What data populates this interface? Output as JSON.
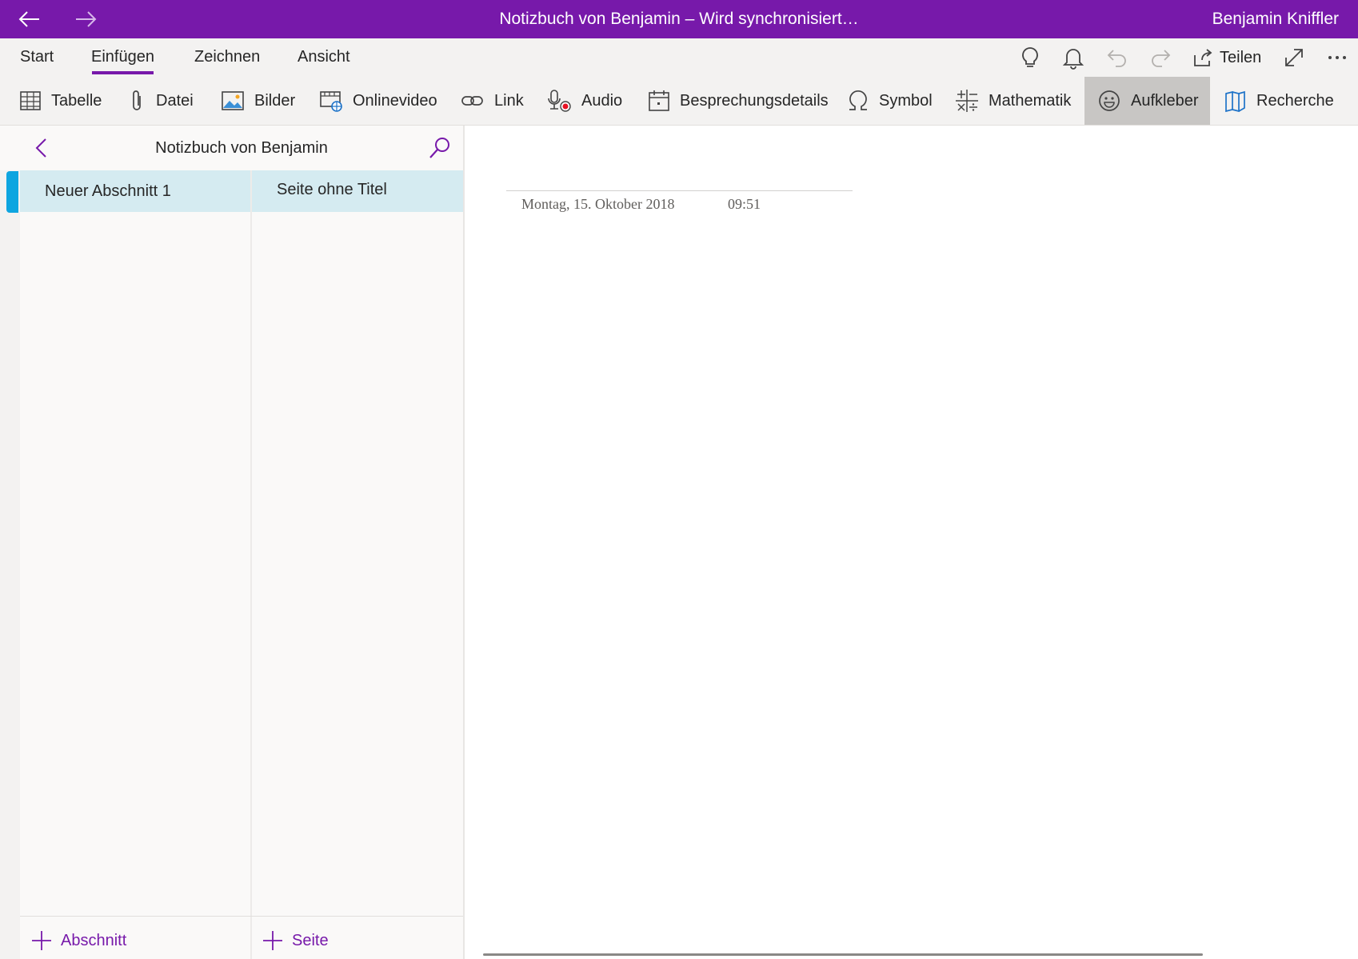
{
  "titlebar": {
    "title": "Notizbuch von Benjamin – Wird synchronisiert…",
    "user": "Benjamin Kniffler"
  },
  "tabs": [
    {
      "label": "Start"
    },
    {
      "label": "Einfügen"
    },
    {
      "label": "Zeichnen"
    },
    {
      "label": "Ansicht"
    }
  ],
  "active_tab": "Einfügen",
  "quick_actions": {
    "share_label": "Teilen"
  },
  "commands": [
    {
      "label": "Tabelle",
      "icon": "table-icon"
    },
    {
      "label": "Datei",
      "icon": "paperclip-icon"
    },
    {
      "label": "Bilder",
      "icon": "image-icon"
    },
    {
      "label": "Onlinevideo",
      "icon": "online-video-icon"
    },
    {
      "label": "Link",
      "icon": "link-icon"
    },
    {
      "label": "Audio",
      "icon": "audio-record-icon"
    },
    {
      "label": "Besprechungsdetails",
      "icon": "calendar-icon"
    },
    {
      "label": "Symbol",
      "icon": "omega-icon"
    },
    {
      "label": "Mathematik",
      "icon": "math-icon"
    },
    {
      "label": "Aufkleber",
      "icon": "smiley-icon"
    },
    {
      "label": "Recherche",
      "icon": "research-icon"
    }
  ],
  "selected_command": "Aufkleber",
  "navigation": {
    "notebook_title": "Notizbuch von Benjamin",
    "sections": [
      {
        "label": "Neuer Abschnitt 1"
      }
    ],
    "pages": [
      {
        "label": "Seite ohne Titel"
      }
    ],
    "add_section_label": "Abschnitt",
    "add_page_label": "Seite"
  },
  "page": {
    "date": "Montag, 15. Oktober 2018",
    "time": "09:51"
  },
  "colors": {
    "accent": "#7719aa",
    "selection": "#d5ebf1",
    "section_marker": "#0ea5e0"
  }
}
